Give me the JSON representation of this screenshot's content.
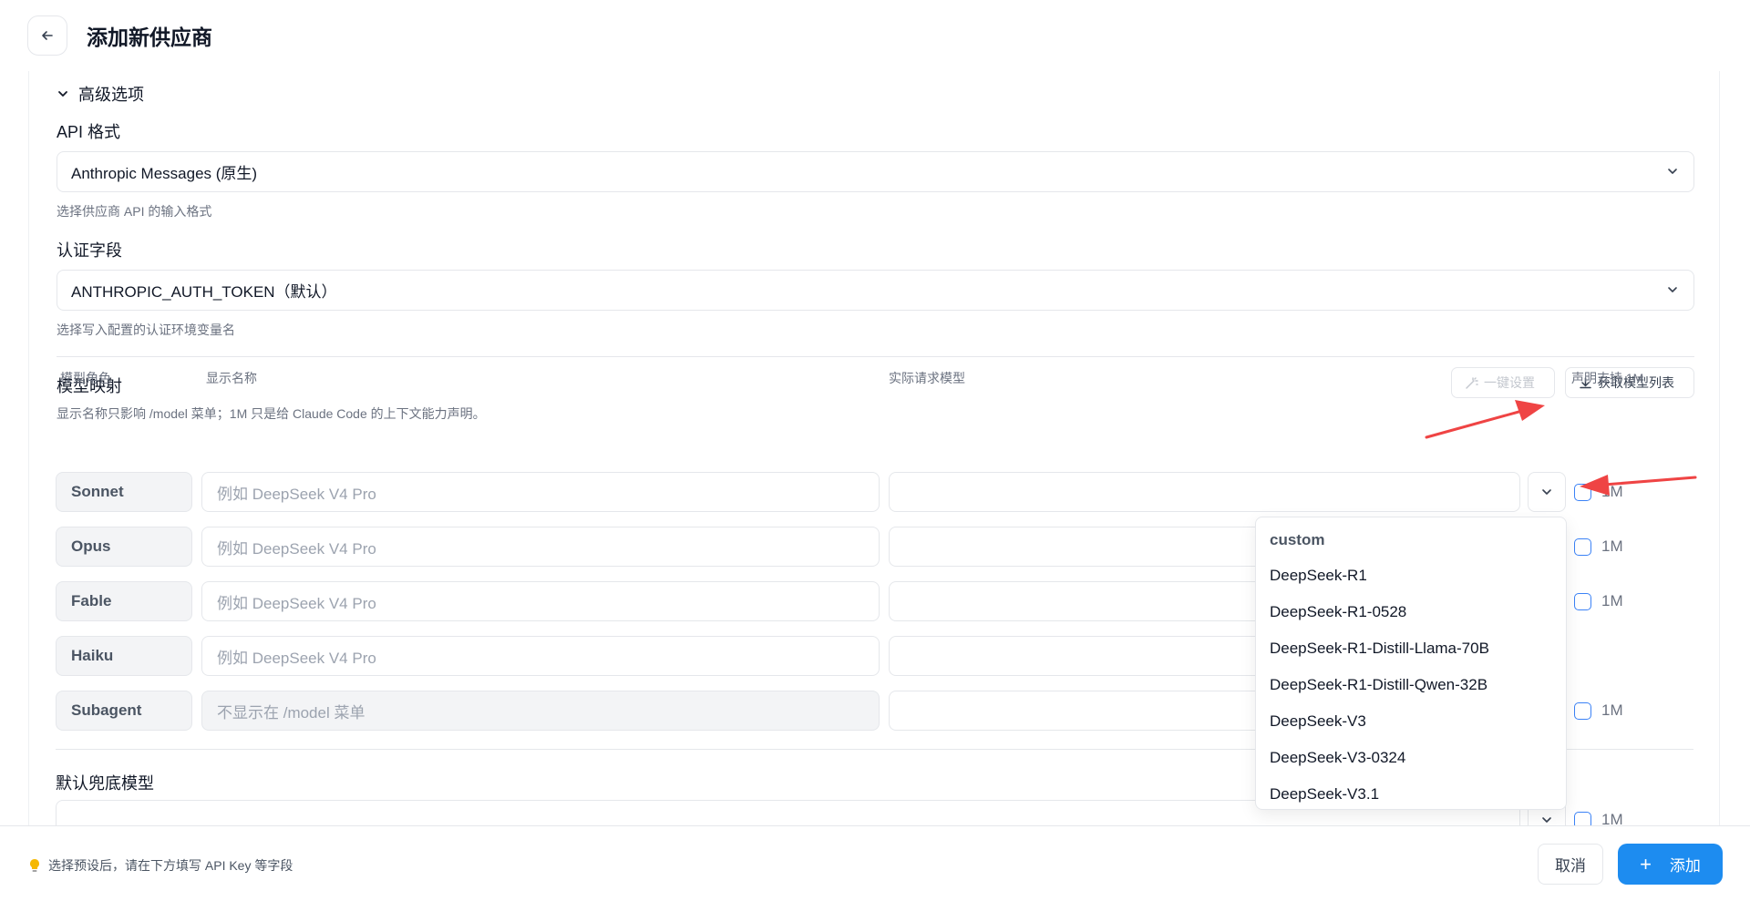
{
  "header": {
    "title": "添加新供应商"
  },
  "advanced": {
    "toggle_label": "高级选项"
  },
  "api_format": {
    "label": "API 格式",
    "value": "Anthropic Messages (原生)",
    "help": "选择供应商 API 的输入格式"
  },
  "auth_field": {
    "label": "认证字段",
    "value": "ANTHROPIC_AUTH_TOKEN（默认）",
    "help": "选择写入配置的认证环境变量名"
  },
  "model_mapping": {
    "title": "模型映射",
    "help": "显示名称只影响 /model 菜单；1M 只是给 Claude Code 的上下文能力声明。",
    "one_click_label": "一键设置",
    "fetch_label": "获取模型列表",
    "columns": {
      "role": "模型角色",
      "display": "显示名称",
      "actual": "实际请求模型",
      "support": "声明支持 1M"
    },
    "rows": [
      {
        "role": "Sonnet",
        "placeholder": "例如 DeepSeek V4 Pro",
        "check_label": "1M"
      },
      {
        "role": "Opus",
        "placeholder": "例如 DeepSeek V4 Pro",
        "check_label": "1M"
      },
      {
        "role": "Fable",
        "placeholder": "例如 DeepSeek V4 Pro",
        "check_label": "1M"
      },
      {
        "role": "Haiku",
        "placeholder": "例如 DeepSeek V4 Pro",
        "check_label": ""
      },
      {
        "role": "Subagent",
        "placeholder": "不显示在 /model 菜单",
        "check_label": "1M"
      }
    ]
  },
  "fallback": {
    "label": "默认兜底模型",
    "check_label": "1M"
  },
  "dropdown": {
    "items": [
      "custom",
      "DeepSeek-R1",
      "DeepSeek-R1-0528",
      "DeepSeek-R1-Distill-Llama-70B",
      "DeepSeek-R1-Distill-Qwen-32B",
      "DeepSeek-V3",
      "DeepSeek-V3-0324",
      "DeepSeek-V3.1"
    ]
  },
  "footer": {
    "tip": "选择预设后，请在下方填写 API Key 等字段",
    "cancel_label": "取消",
    "add_label": "添加",
    "add_icon": "+"
  },
  "colors": {
    "accent": "#1d8cf0",
    "annotation_arrow": "#ef4444"
  }
}
